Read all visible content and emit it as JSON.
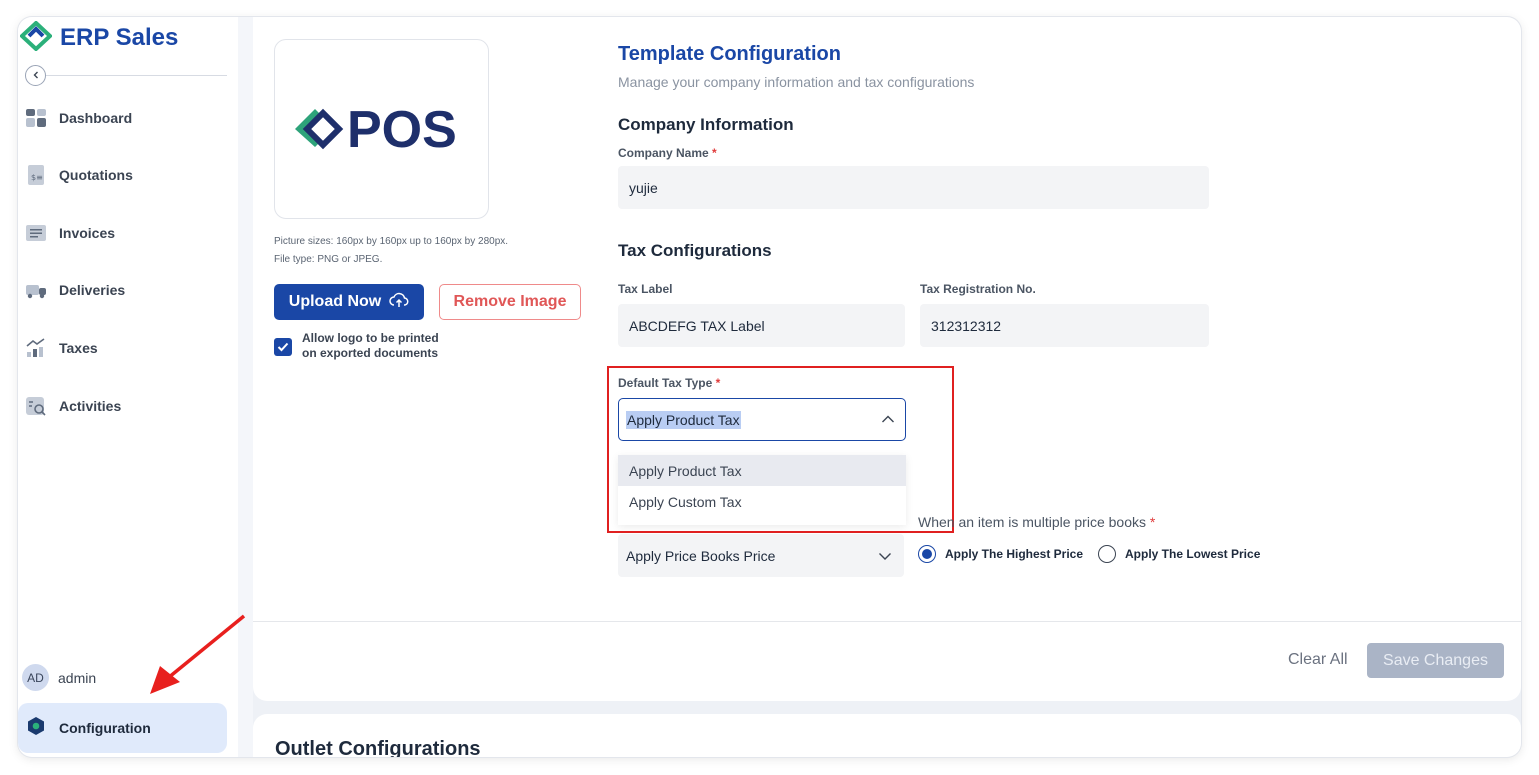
{
  "app": {
    "title": "ERP Sales",
    "brand_color": "#1a47a6",
    "accent_green": "#2bb07a"
  },
  "sidebar": {
    "items": [
      {
        "label": "Dashboard",
        "icon": "dashboard-icon"
      },
      {
        "label": "Quotations",
        "icon": "quotation-icon"
      },
      {
        "label": "Invoices",
        "icon": "invoice-icon"
      },
      {
        "label": "Deliveries",
        "icon": "truck-icon"
      },
      {
        "label": "Taxes",
        "icon": "taxes-chart-icon"
      },
      {
        "label": "Activities",
        "icon": "activities-icon"
      }
    ],
    "user": {
      "initials": "AD",
      "name": "admin"
    },
    "config_label": "Configuration"
  },
  "logo": {
    "text": "POS",
    "note_line1": "Picture sizes: 160px by 160px up to 160px by 280px.",
    "note_line2": "File type: PNG or JPEG.",
    "upload_label": "Upload Now",
    "remove_label": "Remove Image",
    "checkbox_label": "Allow logo to be printed on exported documents",
    "checkbox_checked": true
  },
  "template": {
    "title": "Template Configuration",
    "subtitle": "Manage your company information and tax configurations",
    "company_heading": "Company Information",
    "company_name_label": "Company Name",
    "company_name_value": "yujie",
    "tax_heading": "Tax Configurations",
    "tax_label_label": "Tax Label",
    "tax_label_value": "ABCDEFG TAX Label",
    "tax_reg_label": "Tax Registration No.",
    "tax_reg_value": "312312312",
    "default_tax_label": "Default Tax Type",
    "default_tax_value": "Apply Product Tax",
    "default_tax_options": [
      "Apply Product Tax",
      "Apply Custom Tax"
    ],
    "price_select_value": "Apply Price Books Price",
    "multi_price_label": "When an item is multiple price books",
    "radio_highest": "Apply The Highest Price",
    "radio_lowest": "Apply The Lowest Price",
    "required_mark": "*"
  },
  "footer": {
    "clear_label": "Clear All",
    "save_label": "Save Changes"
  },
  "outlet": {
    "title": "Outlet Configurations"
  }
}
